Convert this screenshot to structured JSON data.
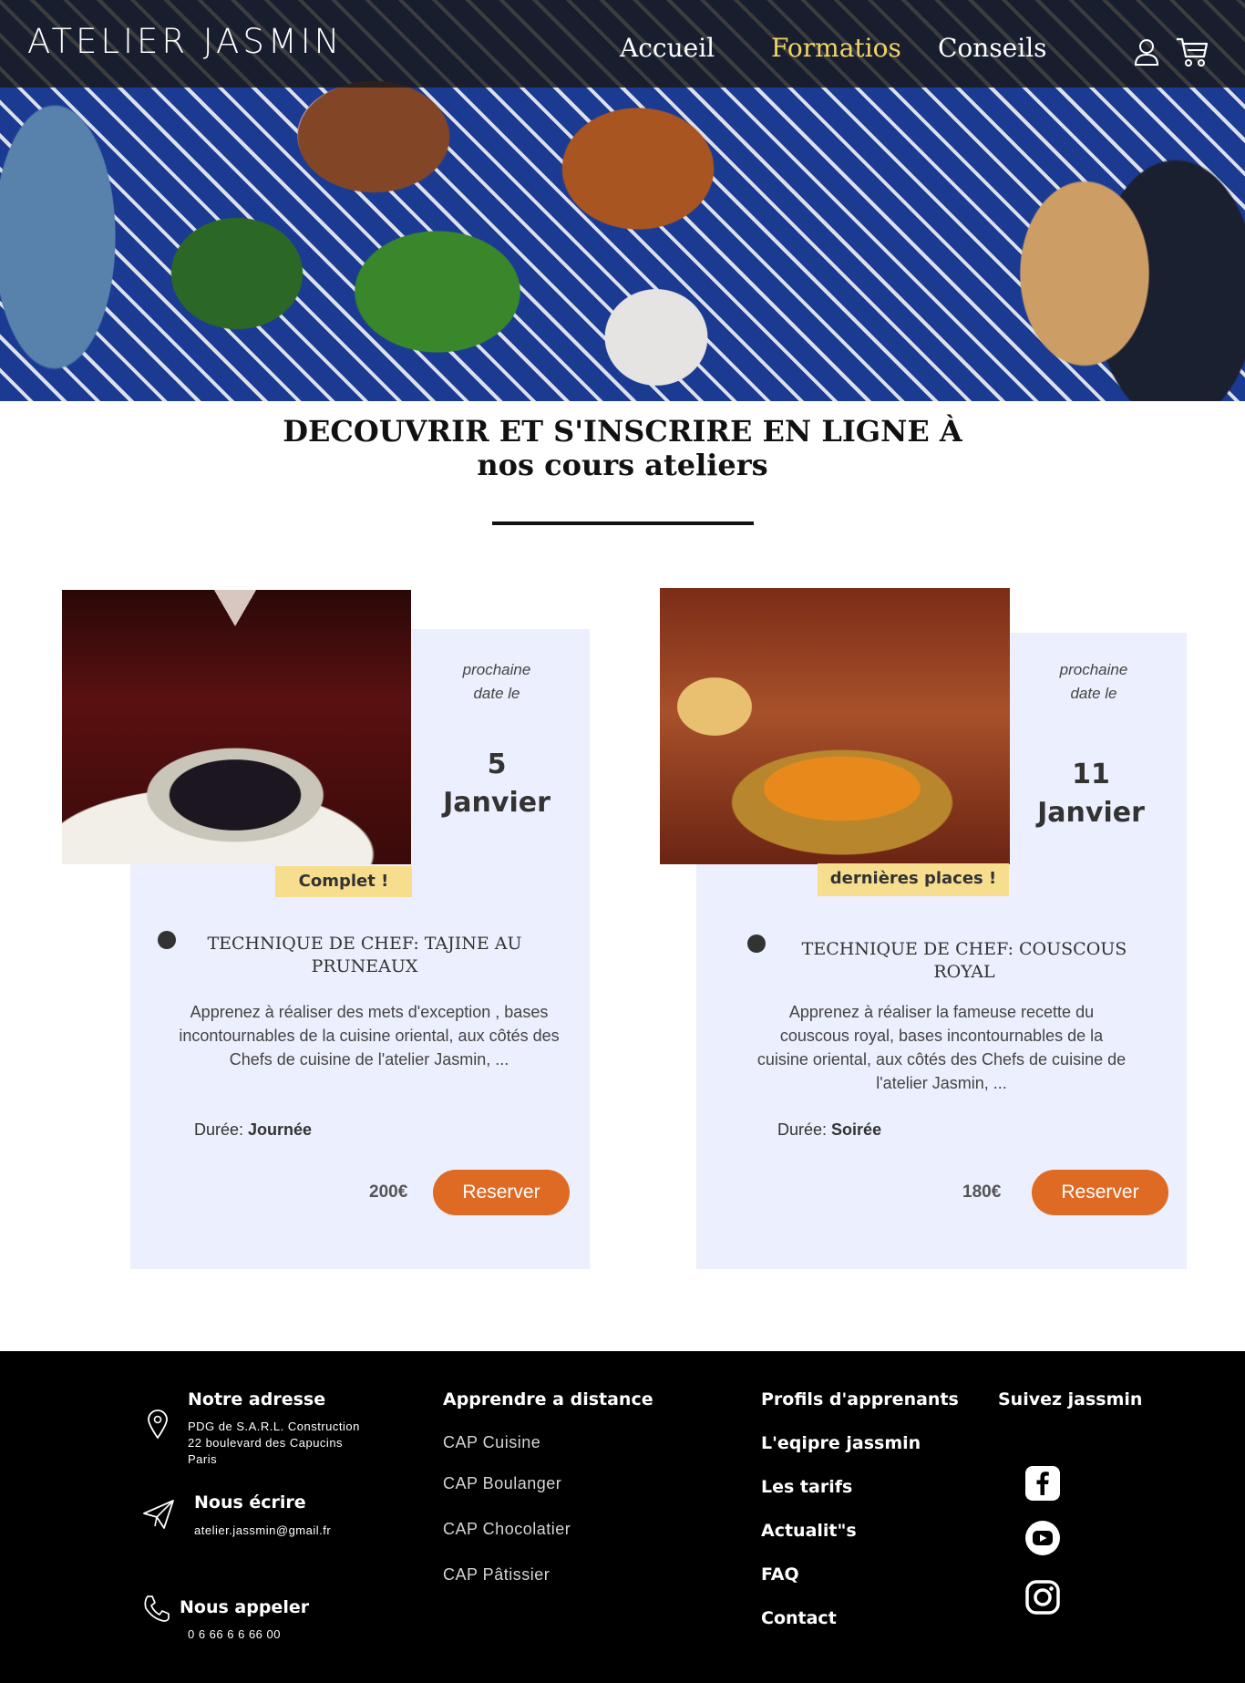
{
  "header": {
    "logo": "ATELIER JASMIN",
    "nav": [
      {
        "label": "Accueil"
      },
      {
        "label": "Formatios"
      },
      {
        "label": "Conseils"
      }
    ],
    "icons": [
      "user-icon",
      "cart-icon"
    ],
    "active_color": "#f1d36a"
  },
  "hero": {
    "image": "cooking-class-tiled-table-photo"
  },
  "section": {
    "title_line1": "DECOUVRIR ET S'INSCRIRE EN LIGNE À",
    "title_line2": "nos cours ateliers"
  },
  "courses": [
    {
      "image": "tajine-photo",
      "badge": "Complet !",
      "date_label_1": "prochaine",
      "date_label_2": "date le",
      "date_day": "5",
      "date_month": "Janvier",
      "title": "TECHNIQUE DE CHEF: TAJINE AU PRUNEAUX",
      "description": "Apprenez à réaliser des mets d'exception , bases incontournables de la cuisine oriental, aux côtés des Chefs de cuisine de l'atelier Jasmin, ...",
      "duration_label": "Durée:",
      "duration_value": "Journée",
      "price": "200€",
      "button": "Reserver"
    },
    {
      "image": "couscous-photo",
      "badge": "dernières places !",
      "date_label_1": "prochaine",
      "date_label_2": "date le",
      "date_day": "11",
      "date_month": "Janvier",
      "title": "TECHNIQUE DE CHEF: COUSCOUS ROYAL",
      "description": "Apprenez à réaliser la fameuse recette du couscous royal, bases incontournables de la cuisine oriental, aux côtés des Chefs de cuisine de l'atelier Jasmin, ...",
      "duration_label": "Durée:",
      "duration_value": "Soirée",
      "price": "180€",
      "button": "Reserver"
    }
  ],
  "footer": {
    "address": {
      "heading": "Notre adresse",
      "line1": "PDG de S.A.R.L. Construction",
      "line2": "22 boulevard des Capucins",
      "line3": "Paris"
    },
    "write": {
      "heading": "Nous écrire",
      "email": "atelier.jassmin@gmail.fr"
    },
    "call": {
      "heading": "Nous appeler",
      "phone": "0 6 66 6 6 66 00"
    },
    "distance": {
      "heading": "Apprendre a distance",
      "links": [
        "CAP Cuisine",
        "CAP Boulanger",
        "CAP Chocolatier",
        "CAP Pâtissier"
      ]
    },
    "links": [
      "Profils d'apprenants",
      "L'eqipre jassmin",
      "Les tarifs",
      "Actualit\"s",
      "FAQ",
      "Contact"
    ],
    "social": {
      "heading": "Suivez jassmin",
      "icons": [
        "facebook-icon",
        "youtube-icon",
        "instagram-icon"
      ]
    }
  },
  "colors": {
    "card_bg": "#eceffd",
    "button": "#de6a24",
    "badge": "#f7dd8e",
    "footer_bg": "#000000"
  }
}
